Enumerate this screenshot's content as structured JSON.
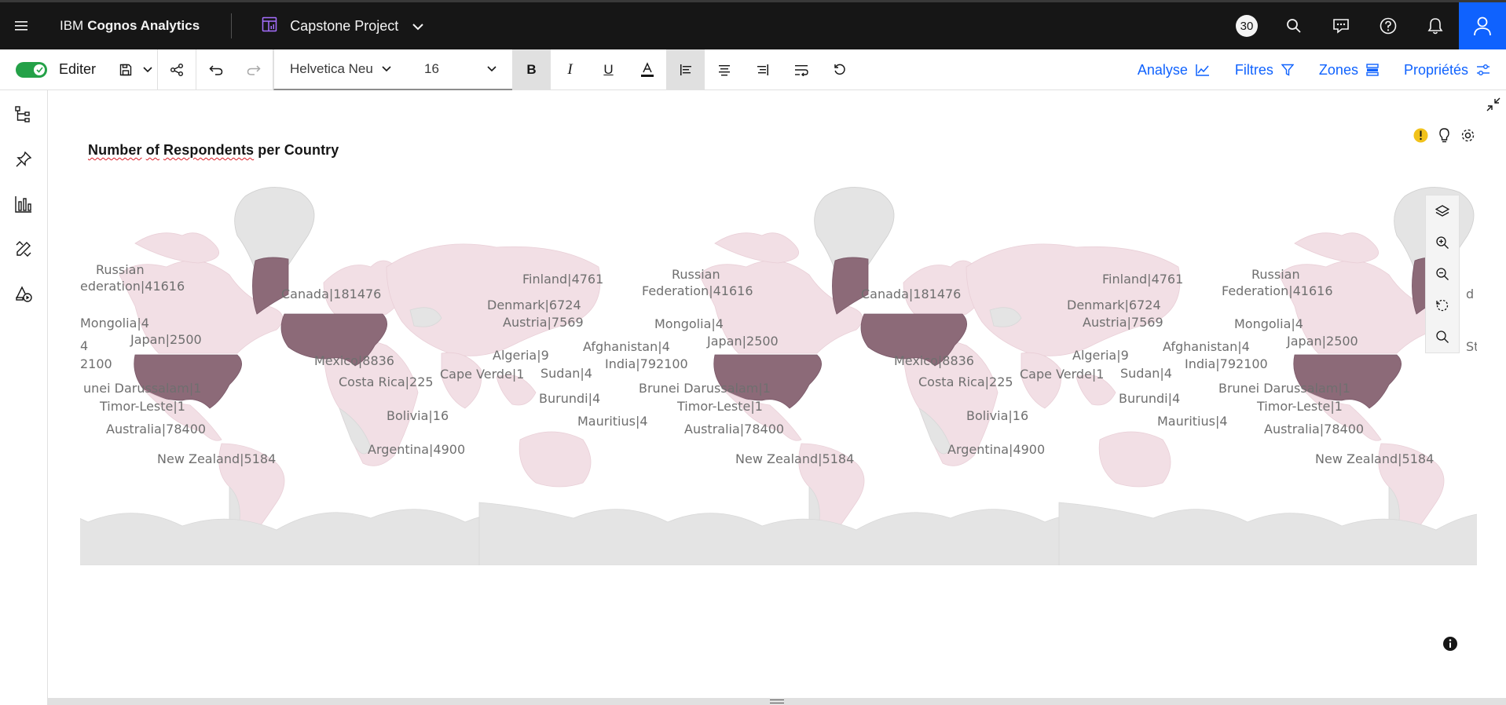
{
  "header": {
    "brand_prefix": "IBM",
    "brand_name": "Cognos Analytics",
    "project_name": "Capstone Project",
    "notification_count": "30"
  },
  "toolbar": {
    "edit_label": "Editer",
    "font_family": "Helvetica Neu",
    "font_size": "16",
    "bold_label": "B",
    "italic_label": "I",
    "underline_label": "U",
    "links": {
      "analyse": "Analyse",
      "filters": "Filtres",
      "zones": "Zones",
      "properties": "Propriétés"
    }
  },
  "visualization": {
    "title_part1": "Number",
    "title_part2": "of",
    "title_part3": "Respondents",
    "title_part4": "per Country",
    "map_labels": {
      "russian_left": "Russian",
      "federation_left": "ederation|41616",
      "mongolia_left": "Mongolia|4",
      "japan_left": "Japan|2500",
      "four_left": "4",
      "india_left": "2100",
      "brunei_left": "unei Darussalam|1",
      "timor_left": "Timor-Leste|1",
      "australia_left": "Australia|78400",
      "newzealand_left": "New Zealand|5184",
      "canada": "Canada|181476",
      "mexico": "Mexico|8836",
      "costarica": "Costa Rica|225",
      "bolivia": "Bolivia|16",
      "argentina": "Argentina|4900",
      "finland": "Finland|4761",
      "denmark": "Denmark|6724",
      "austria": "Austria|7569",
      "algeria": "Algeria|9",
      "capeverde": "Cape Verde|1",
      "sudan": "Sudan|4",
      "burundi": "Burundi|4",
      "mauritius": "Mauritius|4",
      "afghanistan": "Afghanistan|4",
      "india": "India|792100",
      "russian": "Russian",
      "federation": "Federation|41616",
      "mongolia": "Mongolia|4",
      "japan": "Japan|2500",
      "brunei": "Brunei Darussalam|1",
      "timor": "Timor-Leste|1",
      "australia": "Australia|78400",
      "newzealand": "New Zealand|5184",
      "edge_d": "d",
      "edge_st": "St"
    }
  },
  "colors": {
    "highlight_country": "#8c6a78",
    "low_country": "#f2dfe5",
    "no_data": "#e4e4e4",
    "accent": "#0f62fe",
    "toggle_on": "#24a148",
    "warning": "#f1c21b"
  },
  "icons": {
    "menu": "hamburger-icon",
    "dashboard": "dashboard-icon",
    "search": "search-icon",
    "chat": "chat-icon",
    "help": "help-icon",
    "notifications": "bell-icon",
    "user": "user-icon"
  }
}
